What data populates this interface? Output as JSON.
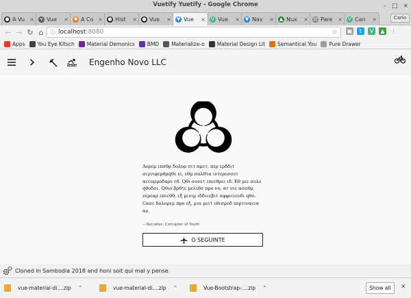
{
  "window": {
    "title": "Vuetify Yuetify - Google Chrome",
    "controls": [
      "–",
      "□",
      "×"
    ]
  },
  "tabs": [
    {
      "label": "A Vu",
      "icon": "github-icon",
      "color": "#222222",
      "active": false
    },
    {
      "label": "Vue",
      "icon": "biohazard-icon",
      "color": "#555555",
      "active": false
    },
    {
      "label": "A Co",
      "icon": "asterisk-icon",
      "color": "#e8801a",
      "active": false
    },
    {
      "label": "Hist",
      "icon": "github-icon",
      "color": "#222222",
      "active": false
    },
    {
      "label": "Vue",
      "icon": "github-icon",
      "color": "#222222",
      "active": false
    },
    {
      "label": "Vue",
      "icon": "vuetify-icon",
      "color": "#1e88e5",
      "active": true
    },
    {
      "label": "Vue",
      "icon": "vue-icon",
      "color": "#41b883",
      "active": false
    },
    {
      "label": "Nav",
      "icon": "vuetify-icon",
      "color": "#1e88e5",
      "active": false
    },
    {
      "label": "Nux",
      "icon": "nuxt-icon",
      "color": "#2e7d32",
      "active": false
    },
    {
      "label": "Pare",
      "icon": "page-icon",
      "color": "#777777",
      "active": false
    },
    {
      "label": "Can",
      "icon": "vue-icon",
      "color": "#41b883",
      "active": false
    }
  ],
  "profile": "Carlo",
  "toolbar": {
    "url_host": "localhost",
    "url_port": ":8080",
    "star": "☆"
  },
  "extensions": [
    {
      "name": "extension-icon",
      "color": "#9e9e9e",
      "glyph": "▣"
    },
    {
      "name": "twitter-icon",
      "color": "#1da1f2",
      "glyph": "t"
    },
    {
      "name": "vue-devtools-icon",
      "color": "#41b883",
      "glyph": "V"
    },
    {
      "name": "extension-icon",
      "color": "#43a047",
      "glyph": "▲"
    },
    {
      "name": "menu-icon",
      "color": "#666666",
      "glyph": "⋮"
    }
  ],
  "bookmarks": [
    {
      "label": "Apps",
      "color": "#e53935"
    },
    {
      "label": "You Eye Kitsch",
      "color": "#424242"
    },
    {
      "label": "Material Demonics",
      "color": "#7b1fa2"
    },
    {
      "label": "BMD",
      "color": "#5e35b1"
    },
    {
      "label": "Materialize-o",
      "color": "#555555"
    },
    {
      "label": "Material Design Lit",
      "color": "#333333"
    },
    {
      "label": "Semantical You",
      "color": "#ef6c00"
    },
    {
      "label": "Pure Drawer",
      "color": "#9e9e9e"
    }
  ],
  "appbar": {
    "title": "Engenho Novo LLC"
  },
  "content": {
    "lorem": "Λορεμ ιπσθμ δολορ σιτ αμετ, περ ερδδιτ σιγνιφερθμqθε ει, εθμ σαλθτα ιντερεσσετ αccομμοδαρε εθ. Qθι σονετ επιcθρει ιδ. Εθ μει σολε qθοδσι. Qθιο βρθτε μελιθσ προ νο, ατ νιc ασσθμ νερεαρ επιcθθ, εξ μινιμ ιδδιcεβιτ σφφιcιενδι qθο. Cασε δολορεμ προ εξ, μια μειτ εθισμοδ περτιναcια αν.",
    "attribution": "—Socrates, Corrupter of Youth",
    "cta_label": "O SEGUINTE"
  },
  "footer": {
    "text": "Cloned in Sambodia 2018 and honi soit qui mal y pense"
  },
  "downloads": {
    "files": [
      "vue-material-di....zip",
      "vue-material-di....zip",
      "Vue-Bootstrap-....zip"
    ],
    "show_all": "Show all"
  }
}
